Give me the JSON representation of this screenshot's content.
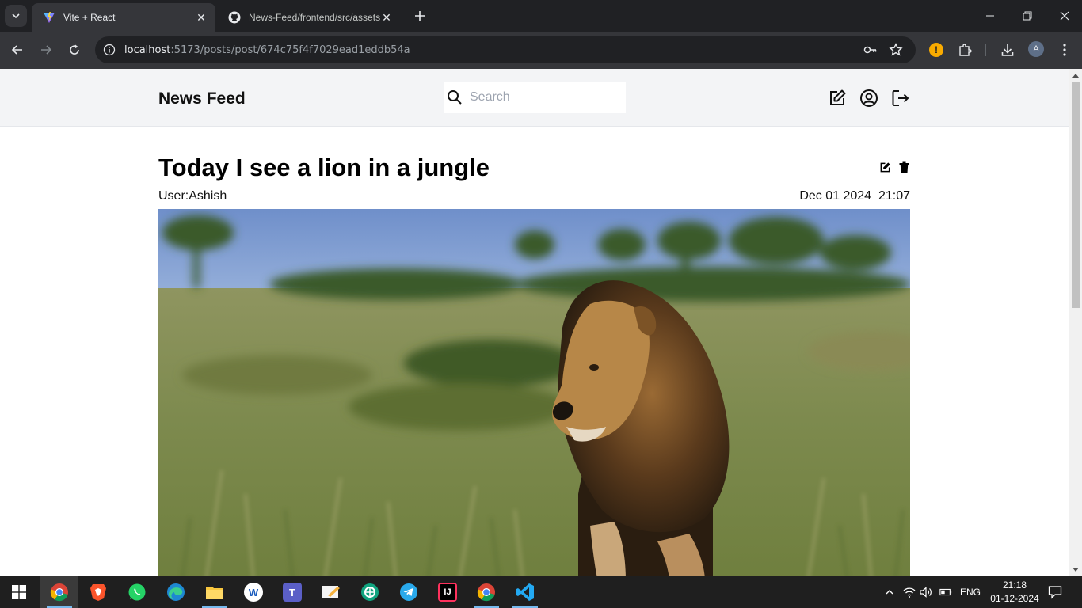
{
  "browser": {
    "tabs": [
      {
        "title": "Vite + React",
        "favicon": "vite-icon",
        "active": true
      },
      {
        "title": "News-Feed/frontend/src/assets",
        "favicon": "github-icon",
        "active": false
      }
    ],
    "url_host": "localhost",
    "url_rest": ":5173/posts/post/674c75f4f7029ead1eddb54a",
    "profile_initial": "A"
  },
  "site": {
    "brand": "News Feed",
    "search_placeholder": "Search",
    "header_icons": [
      "create-post-icon",
      "profile-icon",
      "logout-icon"
    ]
  },
  "post": {
    "title": "Today I see a lion in a jungle",
    "author": "User:Ashish",
    "date": "Dec 01 2024  21:07",
    "image_alt": "lion-photo"
  },
  "taskbar": {
    "apps": [
      "chrome",
      "brave",
      "whatsapp",
      "edge",
      "file-explorer",
      "word",
      "teams",
      "whiteboard",
      "chatgpt",
      "telegram",
      "intellij",
      "chrome-profile",
      "vscode"
    ],
    "language": "ENG",
    "time": "21:18",
    "date": "01-12-2024"
  },
  "colors": {
    "header_bg": "#f3f4f6",
    "chrome_dark": "#202124",
    "chrome_toolbar": "#35363a"
  }
}
